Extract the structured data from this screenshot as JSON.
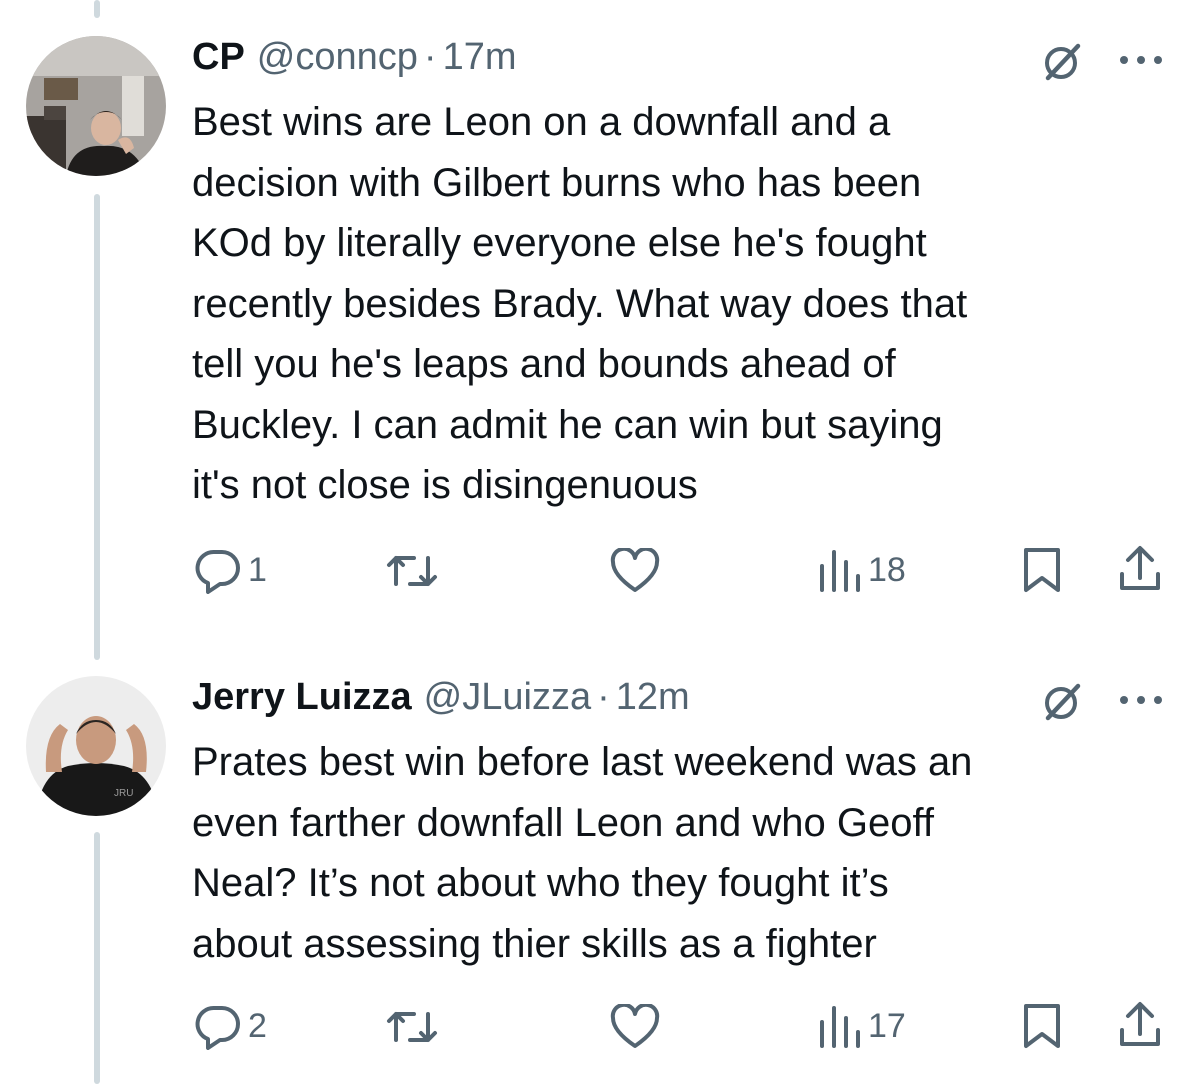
{
  "tweets": [
    {
      "name": "CP",
      "handle": "@conncp",
      "dot": "·",
      "time": "17m",
      "text": "Best wins are Leon on a downfall and a\ndecision with Gilbert burns who has been\nKOd by literally everyone else he's fought\nrecently besides Brady. What way does that\ntell you he's leaps and bounds ahead of\nBuckley. I can admit he can win but saying\nit's not close is disingenuous",
      "replies": "1",
      "views": "18"
    },
    {
      "name": "Jerry Luizza",
      "handle": "@JLuizza",
      "dot": "·",
      "time": "12m",
      "text": "Prates best win before last weekend was an\neven farther downfall Leon and who Geoff\nNeal? It’s not about who they fought it’s\nabout assessing thier skills as a fighter",
      "replies": "2",
      "views": "17",
      "avatar_shirt_text": "JRU"
    }
  ],
  "icons": [
    "grok-icon",
    "more-icon",
    "reply-icon",
    "retweet-icon",
    "like-icon",
    "views-icon",
    "bookmark-icon",
    "share-icon"
  ],
  "colors": {
    "text": "#0f1419",
    "secondary": "#536471",
    "thread_line": "#cfd9de",
    "background": "#ffffff"
  }
}
